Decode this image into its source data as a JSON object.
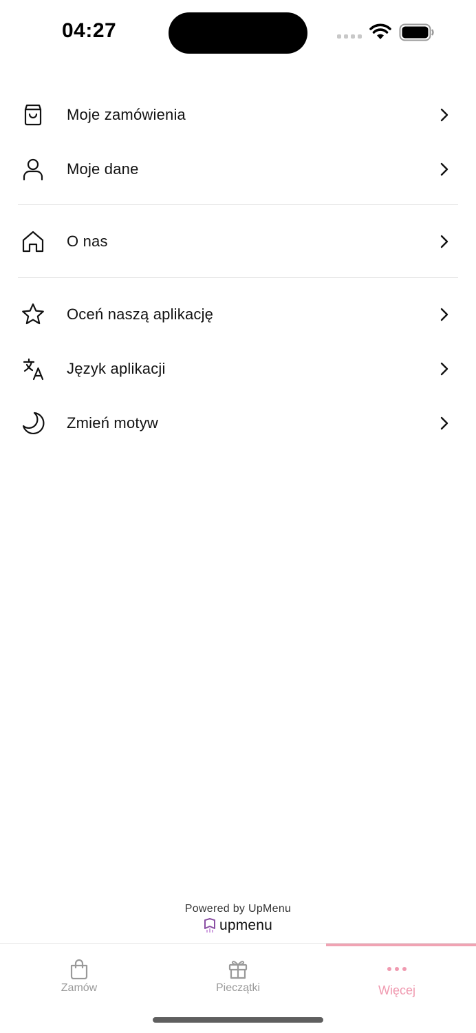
{
  "status_bar": {
    "time": "04:27"
  },
  "menu": {
    "group1": [
      {
        "label": "Moje zamówienia",
        "icon": "shopping-bag-icon"
      },
      {
        "label": "Moje dane",
        "icon": "user-icon"
      }
    ],
    "group2": [
      {
        "label": "O nas",
        "icon": "home-icon"
      }
    ],
    "group3": [
      {
        "label": "Oceń naszą aplikację",
        "icon": "star-icon"
      },
      {
        "label": "Język aplikacji",
        "icon": "translate-icon"
      },
      {
        "label": "Zmień motyw",
        "icon": "moon-icon"
      }
    ]
  },
  "footer": {
    "powered_by": "Powered by UpMenu",
    "brand_name": "upmenu"
  },
  "tab_bar": {
    "tabs": [
      {
        "label": "Zamów",
        "icon": "shopping-bag-icon",
        "active": false
      },
      {
        "label": "Pieczątki",
        "icon": "gift-icon",
        "active": false
      },
      {
        "label": "Więcej",
        "icon": "more-dots-icon",
        "active": true
      }
    ]
  },
  "colors": {
    "accent": "#f09ab0",
    "text": "#111111",
    "inactive_tab": "#999999",
    "divider": "#e2e2e2"
  }
}
